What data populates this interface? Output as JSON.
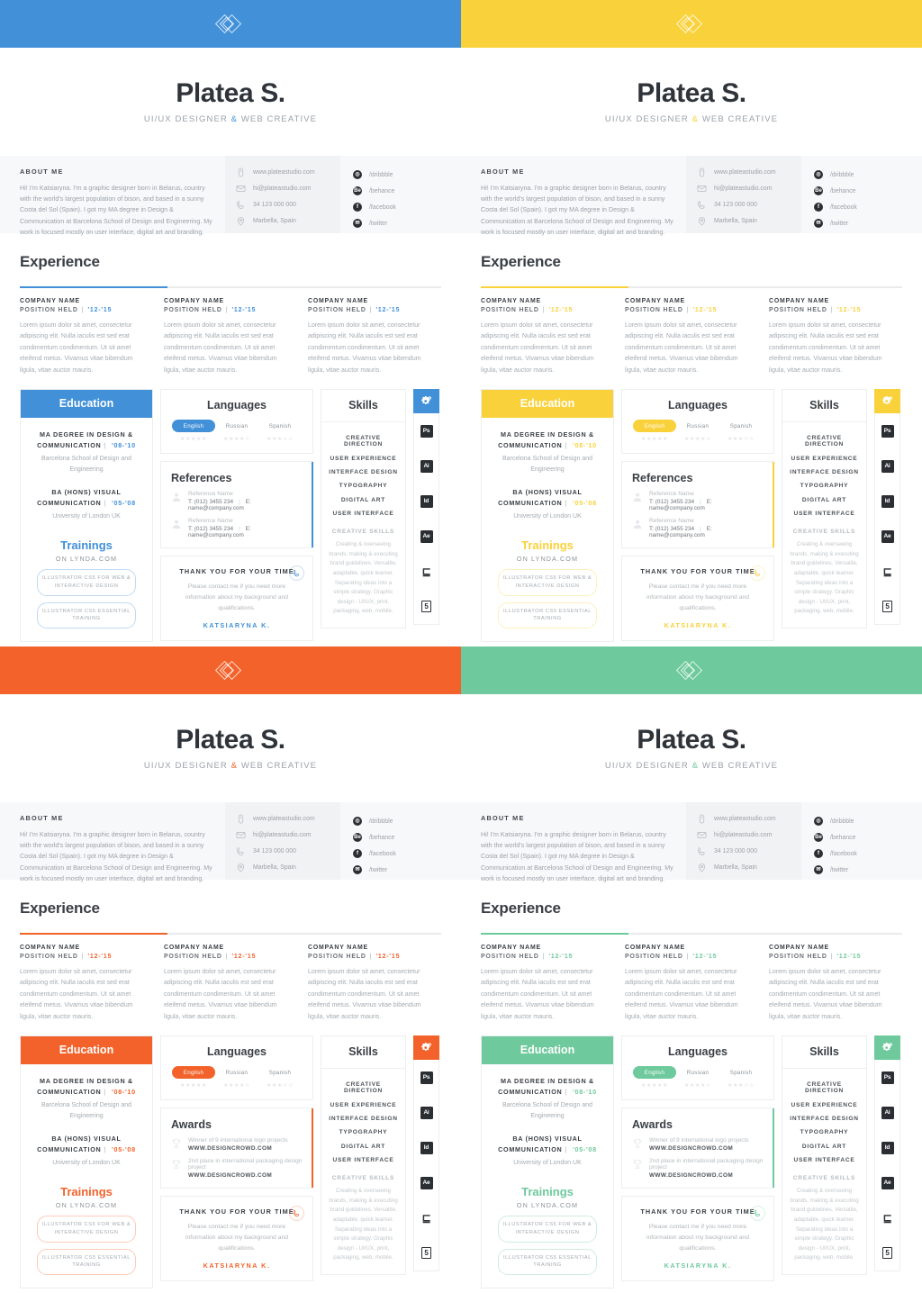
{
  "meta": {
    "variant_count": 4
  },
  "colors": {
    "blue": "#4190d8",
    "yellow": "#f9d13b",
    "orange": "#f2622a",
    "green": "#6ec99c"
  },
  "header": {
    "name": "Platea S.",
    "tagline_left": "UI/UX DESIGNER",
    "tagline_amp": "&",
    "tagline_right": "WEB CREATIVE",
    "logo_icon": "diamond-logo-icon"
  },
  "about": {
    "title": "ABOUT ME",
    "body": "Hi! I'm Katsiaryna. I'm a graphic designer born in Belarus, country with the world's largest population of bison, and based in a sunny Costa del Sol (Spain). I got my MA degree in Design & Communication at Barcelona School of Design and Engineering. My work is focused mostly on user interface, digital art and branding."
  },
  "contact": [
    {
      "icon": "mouse-icon",
      "text": "www.plateastudio.com"
    },
    {
      "icon": "envelope-icon",
      "text": "hi@plateastudio.com"
    },
    {
      "icon": "phone-icon",
      "text": "34 123 000 000"
    },
    {
      "icon": "location-pin-icon",
      "text": "Marbella, Spain"
    }
  ],
  "social": [
    {
      "icon": "dribbble-icon",
      "glyph": "◎",
      "text": "/dribbble"
    },
    {
      "icon": "behance-icon",
      "glyph": "Bе",
      "text": "/behance"
    },
    {
      "icon": "facebook-icon",
      "glyph": "f",
      "text": "/facebook"
    },
    {
      "icon": "twitter-icon",
      "glyph": "✉",
      "text": "/twitter"
    }
  ],
  "experience": {
    "title": "Experience",
    "jobs": [
      {
        "company": "COMPANY NAME",
        "position": "POSITION HELD",
        "years": "'12-'15",
        "body": "Lorem ipsum dolor sit amet, consectetur adipiscing elit. Nulla iaculis est sed erat condimentum condimentum. Ut sit amet eleifend metus. Vivamus vitae bibendum ligula, vitae auctor mauris."
      },
      {
        "company": "COMPANY NAME",
        "position": "POSITION HELD",
        "years": "'12-'15",
        "body": "Lorem ipsum dolor sit amet, consectetur adipiscing elit. Nulla iaculis est sed erat condimentum condimentum. Ut sit amet eleifend metus. Vivamus vitae bibendum ligula, vitae auctor mauris."
      },
      {
        "company": "COMPANY NAME",
        "position": "POSITION HELD",
        "years": "'12-'15",
        "body": "Lorem ipsum dolor sit amet, consectetur adipiscing elit. Nulla iaculis est sed erat condimentum condimentum. Ut sit amet eleifend metus. Vivamus vitae bibendum ligula, vitae auctor mauris."
      }
    ]
  },
  "education": {
    "title": "Education",
    "entries": [
      {
        "degree": "MA DEGREE IN DESIGN & COMMUNICATION",
        "years": "'08-'10",
        "school": "Barcelona School of Design and Engineering"
      },
      {
        "degree": "BA (HONS) VISUAL COMMUNICATION",
        "years": "'05-'08",
        "school": "University of London UK"
      }
    ],
    "trainings_title": "Trainings",
    "trainings_sub": "ON LYNDA.COM",
    "trainings": [
      "ILLUSTRATOR CS5 FOR WEB & INTERACTIVE DESIGN",
      "ILLUSTRATOR CS5 ESSENTIAL TRAINING"
    ]
  },
  "languages": {
    "title": "Languages",
    "items": [
      {
        "label": "English",
        "rating": 5,
        "active": true
      },
      {
        "label": "Russian",
        "rating": 4,
        "active": false
      },
      {
        "label": "Spanish",
        "rating": 3,
        "active": false
      }
    ],
    "max_rating": 5
  },
  "references": {
    "title": "References",
    "items": [
      {
        "name": "Reference Name",
        "phone": "T: (012) 3455 234",
        "sep": "|",
        "email": "E: name@company.com",
        "icon": "user-avatar-icon"
      },
      {
        "name": "Reference Name",
        "phone": "T: (012) 3455 234",
        "sep": "|",
        "email": "E: name@company.com",
        "icon": "user-avatar-icon"
      }
    ]
  },
  "awards": {
    "title": "Awards",
    "items": [
      {
        "name": "Winner of 9 international logo projects",
        "url": "WWW.DESIGNCROWD.COM",
        "icon": "trophy-icon"
      },
      {
        "name": "2nd place in international packaging design project",
        "url": "WWW.DESIGNCROWD.COM",
        "icon": "trophy-icon"
      }
    ]
  },
  "thanks": {
    "title": "THANK YOU FOR YOUR TIME",
    "body": "Please contact me if you need more information about my background and qualifications.",
    "signature": "KATSIARYNA K.",
    "phone_icon": "phone-circle-icon"
  },
  "skills": {
    "title": "Skills",
    "items": [
      "CREATIVE DIRECTION",
      "USER EXPERIENCE",
      "INTERFACE DESIGN",
      "TYPOGRAPHY",
      "DIGITAL ART",
      "USER INTERFACE"
    ],
    "creative_title": "CREATIVE SKILLS",
    "creative_body": "Creating & overseeing brands, making & executing brand guidelines. Versatile, adaptable, quick learner. Separating ideas into a simple strategy. Graphic design - UI/UX, print, packaging, web, mobile.",
    "tool_icons": [
      {
        "icon": "gear-icon",
        "label": ""
      },
      {
        "icon": "photoshop-icon",
        "label": "Ps"
      },
      {
        "icon": "illustrator-icon",
        "label": "Ai"
      },
      {
        "icon": "indesign-icon",
        "label": "Id"
      },
      {
        "icon": "aftereffects-icon",
        "label": "Ae"
      },
      {
        "icon": "css3-icon",
        "label": "⊑"
      },
      {
        "icon": "html5-icon",
        "label": "5"
      }
    ]
  },
  "variants": [
    {
      "key": "blue",
      "accent": "#4190d8",
      "midcard": "references"
    },
    {
      "key": "yellow",
      "accent": "#f9d13b",
      "midcard": "references"
    },
    {
      "key": "orange",
      "accent": "#f2622a",
      "midcard": "awards"
    },
    {
      "key": "green",
      "accent": "#6ec99c",
      "midcard": "awards"
    }
  ]
}
